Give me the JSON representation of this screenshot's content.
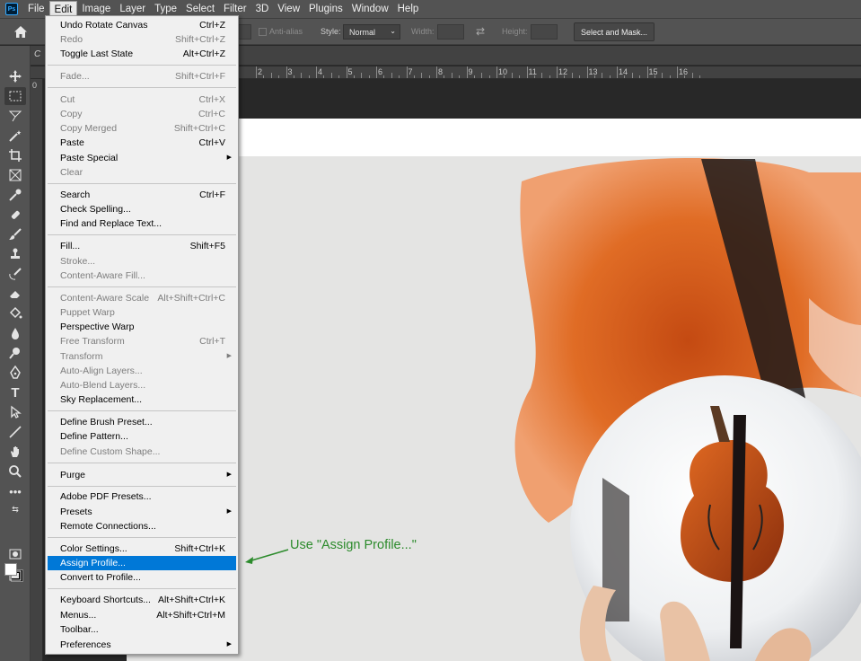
{
  "menubar": {
    "app_icon_text": "Ps",
    "items": [
      "File",
      "Edit",
      "Image",
      "Layer",
      "Type",
      "Select",
      "Filter",
      "3D",
      "View",
      "Plugins",
      "Window",
      "Help"
    ]
  },
  "options": {
    "anti_alias": "Anti-alias",
    "style_label": "Style:",
    "style_value": "Normal",
    "width_label": "Width:",
    "height_label": "Height:",
    "select_mask": "Select and Mask..."
  },
  "document": {
    "tab_initial": "C",
    "ruler_numbers": [
      "2",
      "3",
      "4",
      "5",
      "6",
      "7",
      "8",
      "9",
      "10",
      "11",
      "12",
      "13",
      "14",
      "15",
      "16"
    ]
  },
  "edit_menu": {
    "items": [
      {
        "label": "Undo Rotate Canvas",
        "shortcut": "Ctrl+Z"
      },
      {
        "label": "Redo",
        "shortcut": "Shift+Ctrl+Z"
      },
      {
        "label": "Toggle Last State",
        "shortcut": "Alt+Ctrl+Z"
      },
      {
        "label": "Fade...",
        "shortcut": "Shift+Ctrl+F"
      },
      {
        "label": "Cut",
        "shortcut": "Ctrl+X"
      },
      {
        "label": "Copy",
        "shortcut": "Ctrl+C"
      },
      {
        "label": "Copy Merged",
        "shortcut": "Shift+Ctrl+C"
      },
      {
        "label": "Paste",
        "shortcut": "Ctrl+V"
      },
      {
        "label": "Paste Special",
        "shortcut": ""
      },
      {
        "label": "Clear",
        "shortcut": ""
      },
      {
        "label": "Search",
        "shortcut": "Ctrl+F"
      },
      {
        "label": "Check Spelling...",
        "shortcut": ""
      },
      {
        "label": "Find and Replace Text...",
        "shortcut": ""
      },
      {
        "label": "Fill...",
        "shortcut": "Shift+F5"
      },
      {
        "label": "Stroke...",
        "shortcut": ""
      },
      {
        "label": "Content-Aware Fill...",
        "shortcut": ""
      },
      {
        "label": "Content-Aware Scale",
        "shortcut": "Alt+Shift+Ctrl+C"
      },
      {
        "label": "Puppet Warp",
        "shortcut": ""
      },
      {
        "label": "Perspective Warp",
        "shortcut": ""
      },
      {
        "label": "Free Transform",
        "shortcut": "Ctrl+T"
      },
      {
        "label": "Transform",
        "shortcut": ""
      },
      {
        "label": "Auto-Align Layers...",
        "shortcut": ""
      },
      {
        "label": "Auto-Blend Layers...",
        "shortcut": ""
      },
      {
        "label": "Sky Replacement...",
        "shortcut": ""
      },
      {
        "label": "Define Brush Preset...",
        "shortcut": ""
      },
      {
        "label": "Define Pattern...",
        "shortcut": ""
      },
      {
        "label": "Define Custom Shape...",
        "shortcut": ""
      },
      {
        "label": "Purge",
        "shortcut": ""
      },
      {
        "label": "Adobe PDF Presets...",
        "shortcut": ""
      },
      {
        "label": "Presets",
        "shortcut": ""
      },
      {
        "label": "Remote Connections...",
        "shortcut": ""
      },
      {
        "label": "Color Settings...",
        "shortcut": "Shift+Ctrl+K"
      },
      {
        "label": "Assign Profile...",
        "shortcut": ""
      },
      {
        "label": "Convert to Profile...",
        "shortcut": ""
      },
      {
        "label": "Keyboard Shortcuts...",
        "shortcut": "Alt+Shift+Ctrl+K"
      },
      {
        "label": "Menus...",
        "shortcut": "Alt+Shift+Ctrl+M"
      },
      {
        "label": "Toolbar...",
        "shortcut": ""
      },
      {
        "label": "Preferences",
        "shortcut": ""
      }
    ]
  },
  "annotation": {
    "text": "Use \"Assign Profile...\"",
    "color": "#2c8b2c"
  },
  "colors": {
    "menu_highlight": "#0078d7",
    "panel": "#535353",
    "workspace": "#282828"
  }
}
